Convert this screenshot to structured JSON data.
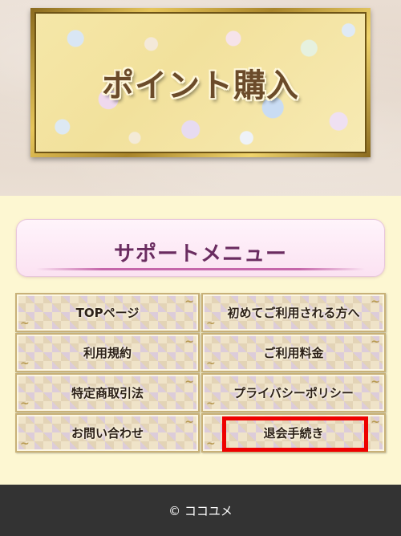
{
  "banner": {
    "title": "ポイント購入"
  },
  "support": {
    "title": "サポートメニュー"
  },
  "menu": {
    "items": [
      {
        "label": "TOPページ",
        "highlighted": false
      },
      {
        "label": "初めてご利用される方へ",
        "highlighted": false
      },
      {
        "label": "利用規約",
        "highlighted": false
      },
      {
        "label": "ご利用料金",
        "highlighted": false
      },
      {
        "label": "特定商取引法",
        "highlighted": false
      },
      {
        "label": "プライバシーポリシー",
        "highlighted": false
      },
      {
        "label": "お問い合わせ",
        "highlighted": false
      },
      {
        "label": "退会手続き",
        "highlighted": true
      }
    ],
    "highlight_color": "#ee0000"
  },
  "footer": {
    "copyright": "© ココユメ"
  },
  "colors": {
    "page_background": "#fdf7d2",
    "support_title": "#6a2c60",
    "footer_background": "#333333"
  }
}
